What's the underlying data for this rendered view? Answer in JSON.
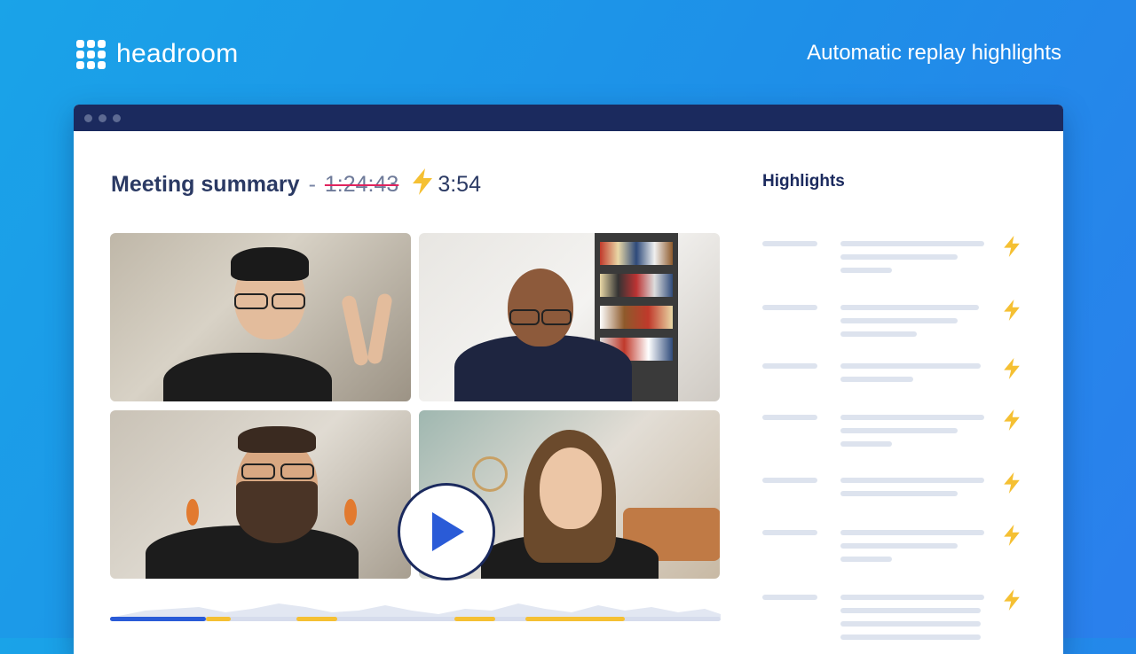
{
  "brand": {
    "name": "headroom"
  },
  "header": {
    "tagline": "Automatic replay highlights"
  },
  "summary": {
    "title": "Meeting summary",
    "separator": "-",
    "original_duration": "1:24:43",
    "short_duration": "3:54"
  },
  "highlights": {
    "title": "Highlights"
  },
  "colors": {
    "accent_blue": "#2a5bd7",
    "accent_yellow": "#f5c033",
    "navy": "#1b2a5e",
    "strike": "#e0245e"
  },
  "icons": {
    "bolt": "lightning-bolt-icon",
    "play": "play-icon"
  }
}
